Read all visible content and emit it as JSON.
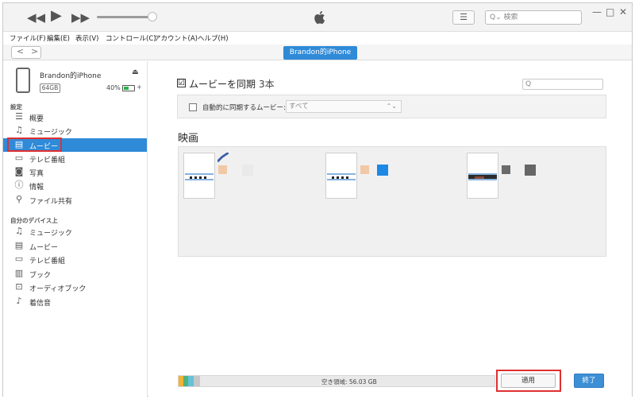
{
  "titlebar": {
    "rewind": "◀◀",
    "play": "▶",
    "forward": "▶▶",
    "list_icon": "list-icon",
    "search_placeholder": "Q⌄ 検索",
    "minimize": "—",
    "maximize": "□",
    "close": "✕"
  },
  "menu": [
    "ファイル(F)",
    "編集(E)",
    "表示(V)",
    "コントロール(C)",
    "アカウント(A)",
    "ヘルプ(H)"
  ],
  "nav": {
    "back": "<",
    "forward": ">",
    "device_pill": "Brandon的iPhone"
  },
  "device": {
    "name": "Brandon的iPhone",
    "eject": "⏏",
    "capacity": "64GB",
    "battery": "40%",
    "battery_level": 0.4,
    "charging": "+"
  },
  "sidebar": {
    "settings_header": "設定",
    "settings_items": [
      {
        "label": "概要",
        "icon": "summary-icon"
      },
      {
        "label": "ミュージック",
        "icon": "music-icon"
      },
      {
        "label": "ムービー",
        "icon": "movie-icon",
        "active": true
      },
      {
        "label": "テレビ番組",
        "icon": "tv-icon"
      },
      {
        "label": "写真",
        "icon": "camera-icon"
      },
      {
        "label": "情報",
        "icon": "info-icon"
      },
      {
        "label": "ファイル共有",
        "icon": "file-share-icon"
      }
    ],
    "device_header": "自分のデバイス上",
    "device_items": [
      {
        "label": "ミュージック",
        "icon": "music-icon"
      },
      {
        "label": "ムービー",
        "icon": "movie-icon"
      },
      {
        "label": "テレビ番組",
        "icon": "tv-icon"
      },
      {
        "label": "ブック",
        "icon": "book-icon"
      },
      {
        "label": "オーディオブック",
        "icon": "audiobook-icon"
      },
      {
        "label": "着信音",
        "icon": "bell-icon"
      }
    ]
  },
  "main": {
    "sync_checked": "☑",
    "sync_title": "ムービーを同期",
    "sync_count": "3本",
    "search_icon": "Q",
    "auto_sync_label": "自動的に同期するムービー:",
    "auto_sync_value": "すべて",
    "movies_header": "映画",
    "movies": [
      {
        "badge_color": "#e9e9e9",
        "badge2_color": "#f1c9a6",
        "thumb_dark": false
      },
      {
        "badge_color": "#1e88e5",
        "badge2_color": "#f1c9a6",
        "thumb_dark": false
      },
      {
        "badge_color": "#666666",
        "badge2_color": "#6a6a6a",
        "thumb_dark": true
      }
    ]
  },
  "footer": {
    "free_space": "空き領域: 56.03 GB",
    "apply": "適用",
    "done": "終了"
  },
  "colors": {
    "accent": "#2f8ad8",
    "highlight_box": "#e03030",
    "storage_segments": [
      "#f2b233",
      "#4db27f",
      "#66c2d9",
      "#c7c7c7"
    ]
  }
}
